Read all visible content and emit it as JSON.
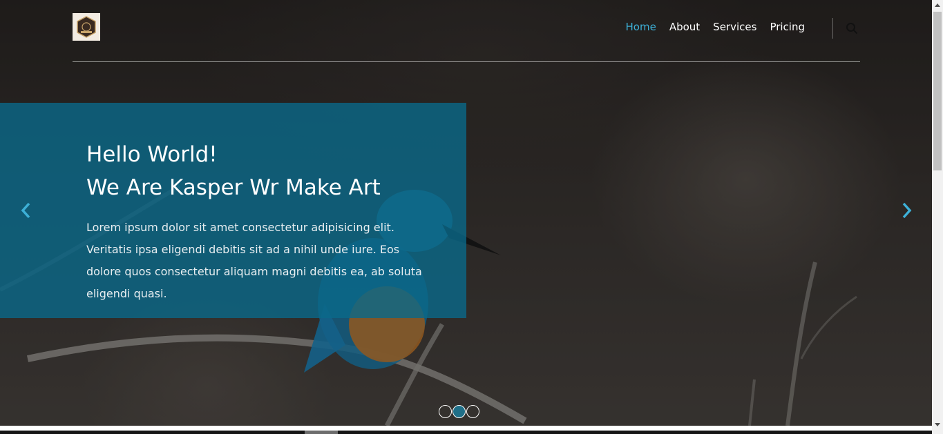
{
  "nav": {
    "logo_alt": "logo",
    "links": [
      {
        "label": "Home",
        "active": true
      },
      {
        "label": "About",
        "active": false
      },
      {
        "label": "Services",
        "active": false
      },
      {
        "label": "Pricing",
        "active": false
      }
    ],
    "search_icon": "search-icon"
  },
  "hero": {
    "title_line1": "Hello World!",
    "title_line2": "We Are Kasper Wr Make Art",
    "text": "Lorem ipsum dolor sit amet consectetur adipisicing elit. Veritatis ipsa eligendi debitis sit ad a nihil unde iure. Eos dolore quos consectetur aliquam magni debitis ea, ab soluta eligendi quasi.",
    "prev_icon": "chevron-left-icon",
    "next_icon": "chevron-right-icon",
    "slides_count": 3,
    "active_slide": 2
  },
  "colors": {
    "accent": "#3db0d7",
    "panel": "#0a698a",
    "active_bullet": "#1f6f88"
  }
}
